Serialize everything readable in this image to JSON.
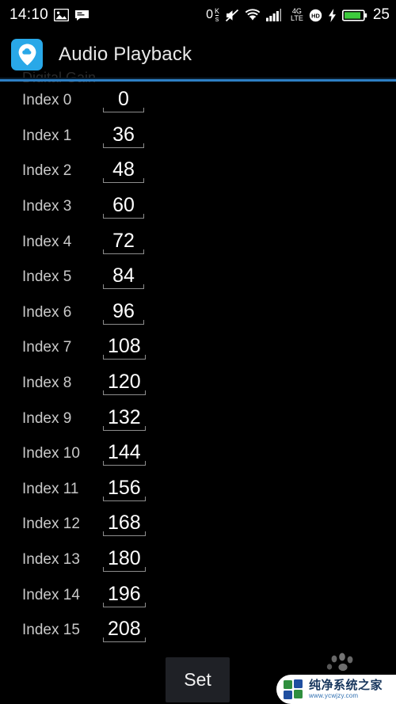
{
  "statusbar": {
    "time": "14:10",
    "left_icons": [
      "image-icon",
      "message-icon"
    ],
    "data_rate": "0",
    "data_rate_unit_top": "K",
    "data_rate_unit_bottom": "s",
    "right_icons": [
      "mute-icon",
      "wifi-icon",
      "signal-icon",
      "4g-lte-icon",
      "hd-icon",
      "charging-bolt-icon",
      "battery-icon"
    ],
    "network_type_top": "4G",
    "network_type_bottom": "LTE",
    "hd_label": "HD",
    "battery_percent": "25"
  },
  "appbar": {
    "icon": "cloud-pin-icon",
    "title": "Audio Playback"
  },
  "section": {
    "scrolled_label": "Digital Gain"
  },
  "list": {
    "rows": [
      {
        "label": "Index 0",
        "value": "0"
      },
      {
        "label": "Index 1",
        "value": "36"
      },
      {
        "label": "Index 2",
        "value": "48"
      },
      {
        "label": "Index 3",
        "value": "60"
      },
      {
        "label": "Index 4",
        "value": "72"
      },
      {
        "label": "Index 5",
        "value": "84"
      },
      {
        "label": "Index 6",
        "value": "96"
      },
      {
        "label": "Index 7",
        "value": "108"
      },
      {
        "label": "Index 8",
        "value": "120"
      },
      {
        "label": "Index 9",
        "value": "132"
      },
      {
        "label": "Index 10",
        "value": "144"
      },
      {
        "label": "Index 11",
        "value": "156"
      },
      {
        "label": "Index 12",
        "value": "168"
      },
      {
        "label": "Index 13",
        "value": "180"
      },
      {
        "label": "Index 14",
        "value": "196"
      },
      {
        "label": "Index 15",
        "value": "208"
      }
    ]
  },
  "actions": {
    "set_label": "Set"
  },
  "watermark": {
    "paw": "paw-print-icon",
    "logo": "four-square-logo-icon",
    "name": "纯净系统之家",
    "url": "www.ycwjzy.com"
  },
  "colors": {
    "accent": "#29a8e8",
    "divider": "#2d7fc4",
    "background": "#000000",
    "battery_green": "#3ecb3e",
    "button": "#1f2126"
  }
}
